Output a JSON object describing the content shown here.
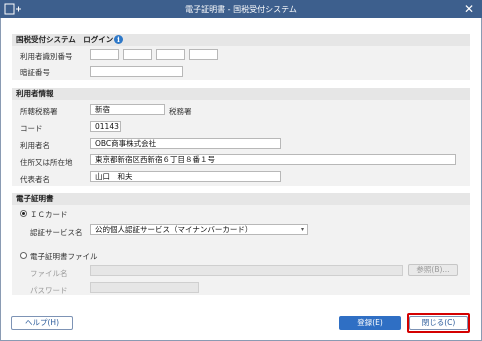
{
  "window": {
    "title": "電子証明書 - 国税受付システム",
    "left_icon": "window-plus-icon",
    "close_icon": "close-icon"
  },
  "login_section": {
    "header": "国税受付システム　ログイン",
    "info_icon": "info-icon",
    "user_id_label": "利用者識別番号",
    "user_id_parts": [
      "",
      "",
      "",
      ""
    ],
    "password_label": "暗証番号",
    "password_value": ""
  },
  "user_section": {
    "header": "利用者情報",
    "tax_office_label": "所轄税務署",
    "tax_office_value": "新宿",
    "tax_office_suffix": "税務署",
    "code_label": "コード",
    "code_value": "01143",
    "user_name_label": "利用者名",
    "user_name_value": "OBC商事株式会社",
    "address_label": "住所又は所在地",
    "address_value": "東京都新宿区西新宿６丁目８番１号",
    "representative_label": "代表者名",
    "representative_value": "山口　和夫"
  },
  "cert_section": {
    "header": "電子証明書",
    "ic_card_label": "ＩＣカード",
    "auth_service_label": "認証サービス名",
    "auth_service_value": "公的個人認証サービス（マイナンバーカード）",
    "cert_file_label": "電子証明書ファイル",
    "file_name_label": "ファイル名",
    "file_name_value": "",
    "browse_label": "参照(B)...",
    "password_label": "パスワード",
    "password_value": ""
  },
  "footer": {
    "help_label": "ヘルプ(H)",
    "register_label": "登録(E)",
    "close_label": "閉じる(C)"
  },
  "colors": {
    "titlebar": "#3d5f8d",
    "primary": "#2f6fc4",
    "highlight": "#d40000"
  }
}
